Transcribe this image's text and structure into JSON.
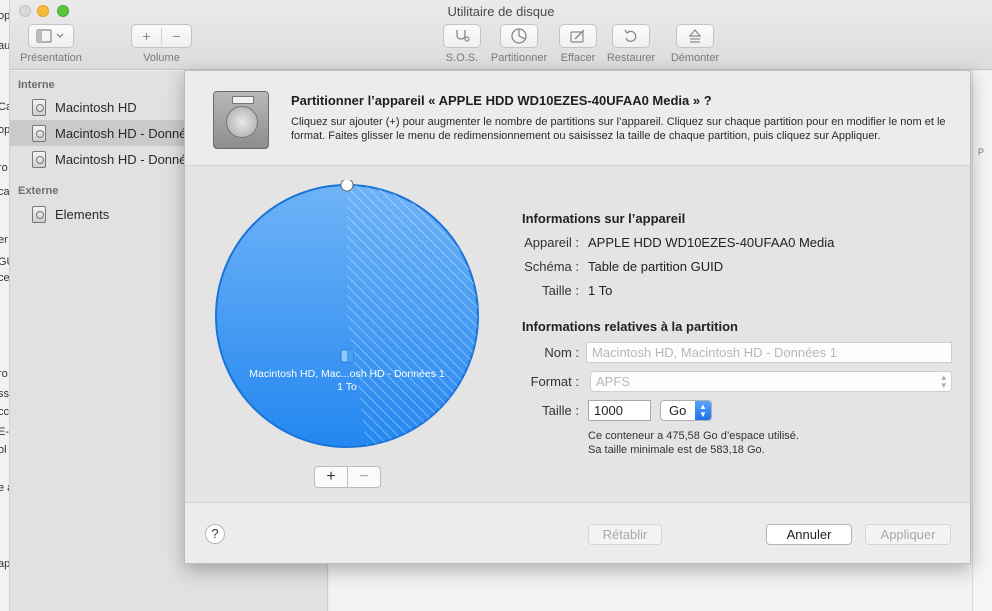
{
  "window": {
    "title": "Utilitaire de disque",
    "toolbar": {
      "presentation_label": "Présentation",
      "volume_label": "Volume",
      "volume_add": "+",
      "volume_remove": "−",
      "sos_label": "S.O.S.",
      "partition_label": "Partitionner",
      "erase_label": "Effacer",
      "restore_label": "Restaurer",
      "unmount_label": "Démonter"
    }
  },
  "edge_strip": {
    "fragments": [
      "op",
      "au",
      "Ca",
      "op",
      "ro",
      "ca",
      "er",
      "GU",
      "ce",
      "ro",
      "ss",
      "cc",
      "E-",
      "ol",
      "e a",
      "ap"
    ]
  },
  "right_edge": {
    "fragment": "P"
  },
  "sidebar": {
    "internal_header": "Interne",
    "external_header": "Externe",
    "items": [
      {
        "label": "Macintosh HD"
      },
      {
        "label": "Macintosh HD - Données"
      },
      {
        "label": "Macintosh HD - Données"
      },
      {
        "label": "Elements"
      }
    ]
  },
  "sheet": {
    "title": "Partitionner l’appareil « APPLE HDD WD10EZES-40UFAA0 Media » ?",
    "description": "Cliquez sur ajouter (+) pour augmenter le nombre de partitions sur l’appareil. Cliquez sur chaque partition pour en modifier le nom et le format. Faites glisser le menu de redimensionnement ou saisissez la taille de chaque partition, puis cliquez sur Appliquer.",
    "pie": {
      "label": "Macintosh HD, Mac...osh HD - Données 1",
      "size": "1 To",
      "used_fraction": 0.4758,
      "add_button": "+",
      "remove_button": "−"
    },
    "device_info": {
      "title": "Informations sur l’appareil",
      "device_label": "Appareil :",
      "device_value": "APPLE HDD WD10EZES-40UFAA0 Media",
      "scheme_label": "Schéma :",
      "scheme_value": "Table de partition GUID",
      "size_label": "Taille :",
      "size_value": "1 To"
    },
    "partition_info": {
      "title": "Informations relatives à la partition",
      "name_label": "Nom :",
      "name_value": "Macintosh HD, Macintosh HD - Données 1",
      "format_label": "Format :",
      "format_value": "APFS",
      "size_label": "Taille :",
      "size_value": "1000",
      "unit_value": "Go",
      "note_line1": "Ce conteneur a 475,58 Go d’espace utilisé.",
      "note_line2": "Sa taille minimale est de 583,18 Go."
    },
    "buttons": {
      "help": "?",
      "revert": "Rétablir",
      "cancel": "Annuler",
      "apply": "Appliquer"
    }
  }
}
